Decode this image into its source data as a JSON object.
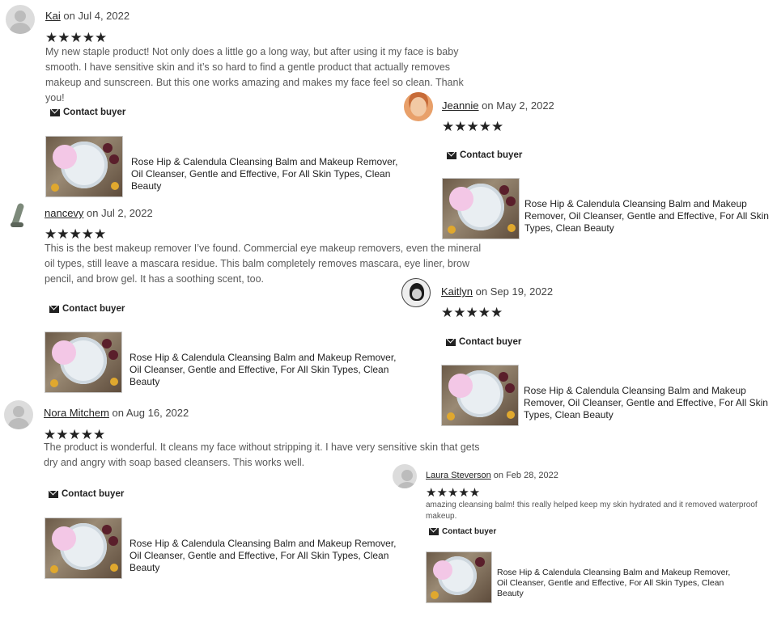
{
  "reviews": [
    {
      "name": "Kai",
      "date_text": "on Jul 4, 2022",
      "stars": "★★★★★",
      "text": "My new staple product! Not only does a little go a long way, but after using it my face is baby smooth. I have sensitive skin and it’s so hard to find a gentle product that actually removes makeup and sunscreen. But this one works amazing and makes my face feel so clean. Thank you!",
      "contact_label": "Contact buyer",
      "product_title": "Rose Hip & Calendula Cleansing Balm and Makeup Remover, Oil Cleanser, Gentle and Effective, For All Skin Types, Clean Beauty"
    },
    {
      "name": "Jeannie",
      "date_text": "on May 2, 2022",
      "stars": "★★★★★",
      "text": "",
      "contact_label": "Contact buyer",
      "product_title": "Rose Hip & Calendula Cleansing Balm and Makeup Remover, Oil Cleanser, Gentle and Effective, For All Skin Types, Clean Beauty"
    },
    {
      "name": "nancevy",
      "date_text": "on Jul 2, 2022",
      "stars": "★★★★★",
      "text": "This is the best makeup remover I’ve found. Commercial eye makeup removers, even the mineral oil types, still leave a mascara residue. This balm completely removes mascara, eye liner, brow pencil, and brow gel. It has a soothing scent, too.",
      "contact_label": "Contact buyer",
      "product_title": "Rose Hip & Calendula Cleansing Balm and Makeup Remover, Oil Cleanser, Gentle and Effective, For All Skin Types, Clean Beauty"
    },
    {
      "name": "Kaitlyn",
      "date_text": "on Sep 19, 2022",
      "stars": "★★★★★",
      "text": "",
      "contact_label": "Contact buyer",
      "product_title": "Rose Hip & Calendula Cleansing Balm and Makeup Remover, Oil Cleanser, Gentle and Effective, For All Skin Types, Clean Beauty"
    },
    {
      "name": "Nora Mitchem",
      "date_text": "on Aug 16, 2022",
      "stars": "★★★★★",
      "text": "The product is wonderful. It cleans my face without stripping it. I have very sensitive skin that gets dry and angry with soap based cleansers. This works well.",
      "contact_label": "Contact buyer",
      "product_title": "Rose Hip & Calendula Cleansing Balm and Makeup Remover, Oil Cleanser, Gentle and Effective, For All Skin Types, Clean Beauty"
    },
    {
      "name": "Laura Steverson",
      "date_text": "on Feb 28, 2022",
      "stars": "★★★★★",
      "text": "amazing cleansing balm! this really helped keep my skin hydrated and it removed waterproof makeup.",
      "contact_label": "Contact buyer",
      "product_title": "Rose Hip & Calendula Cleansing Balm and Makeup Remover, Oil Cleanser, Gentle and Effective, For All Skin Types, Clean Beauty"
    }
  ],
  "ratings": [
    5,
    5,
    5,
    5,
    5,
    5
  ]
}
